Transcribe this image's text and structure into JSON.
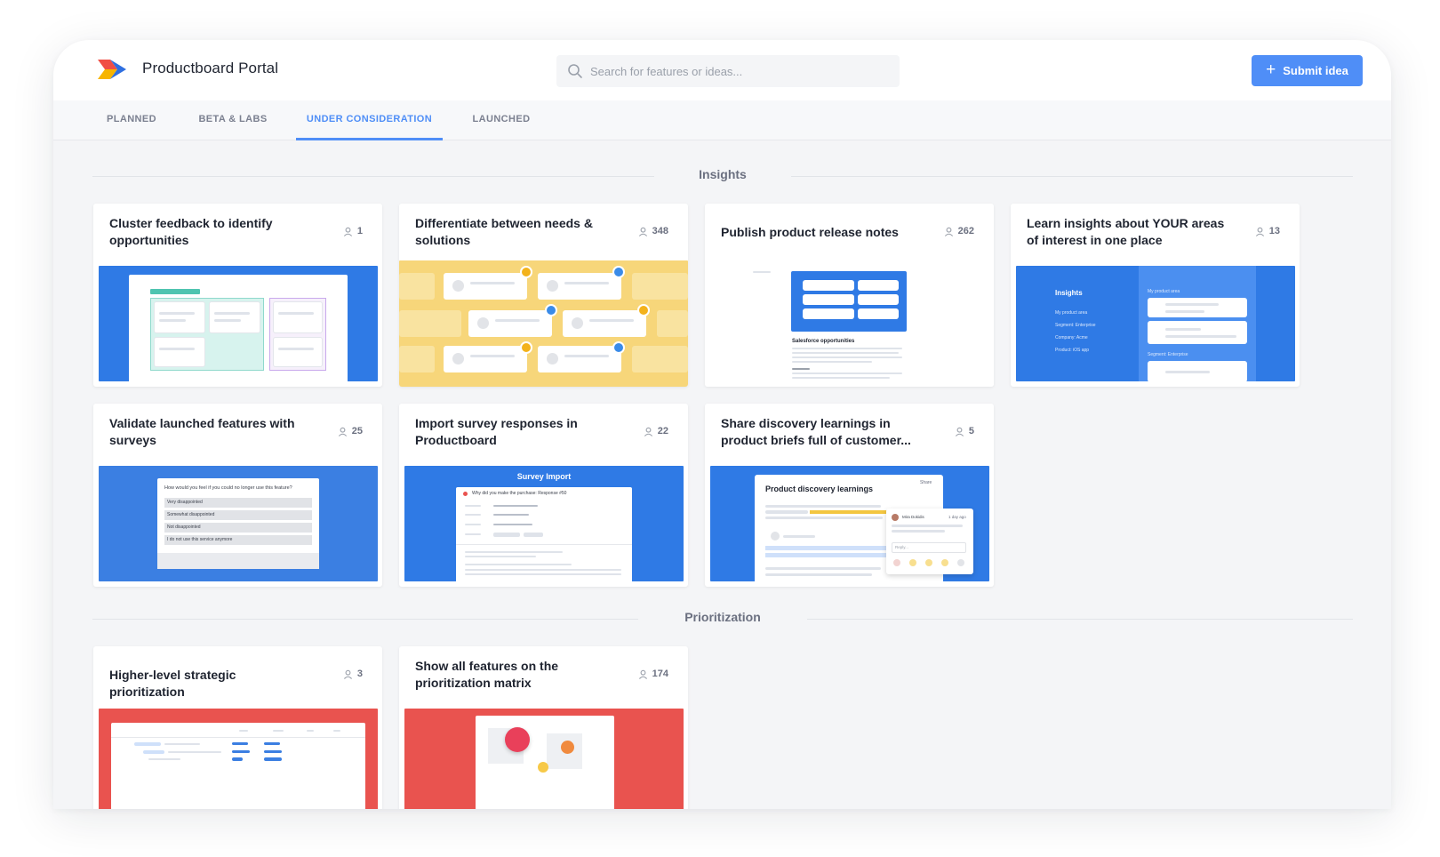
{
  "app": {
    "title": "Productboard Portal"
  },
  "search": {
    "placeholder": "Search for features or ideas..."
  },
  "submit": {
    "label": "Submit idea"
  },
  "tabs": [
    "PLANNED",
    "BETA & LABS",
    "UNDER CONSIDERATION",
    "LAUNCHED"
  ],
  "active_tab": "UNDER CONSIDERATION",
  "colors": {
    "accent": "#4f8ef7",
    "thumb_blue": "#2f7ae5",
    "thumb_yellow": "#f7d67a",
    "thumb_red": "#e9534f"
  },
  "sections": {
    "insights": {
      "label": "Insights",
      "cards": [
        {
          "title": "Cluster feedback to identify opportunities",
          "count": "1"
        },
        {
          "title": "Differentiate between needs & solutions",
          "count": "348"
        },
        {
          "title": "Publish product release notes",
          "count": "262"
        },
        {
          "title": "Learn insights about YOUR areas of interest in one place",
          "count": "13"
        },
        {
          "title": "Validate launched features with surveys",
          "count": "25"
        },
        {
          "title": "Import survey responses in Productboard",
          "count": "22"
        },
        {
          "title": "Share discovery learnings in product briefs full of customer...",
          "count": "5"
        }
      ]
    },
    "prioritization": {
      "label": "Prioritization",
      "cards": [
        {
          "title": "Higher-level strategic prioritization",
          "count": "3"
        },
        {
          "title": "Show all features on the prioritization matrix",
          "count": "174"
        }
      ]
    }
  },
  "thumbs": {
    "release_notes": {
      "heading": "Salesforce opportunities"
    },
    "insights_panel": {
      "heading": "Insights",
      "filters": [
        "My product area",
        "Segment: Enterprise",
        "Company: Acme",
        "Product: iOS app"
      ],
      "right_labels": [
        "My product area",
        "Segment: Enterprise"
      ]
    },
    "survey_question": {
      "question": "How would you feel if you could no longer use this feature?",
      "options": [
        "Very disappointed",
        "Somewhat disappointed",
        "Not disappointed",
        "I do not use this service anymore"
      ]
    },
    "survey_import": {
      "heading": "Survey Import",
      "row": "Why did you make the purchase: Response #50"
    },
    "discovery": {
      "heading": "Product discovery learnings",
      "share": "Share",
      "user": "Mira Dokidis",
      "time": "1 day ago",
      "reply": "Reply..."
    }
  }
}
